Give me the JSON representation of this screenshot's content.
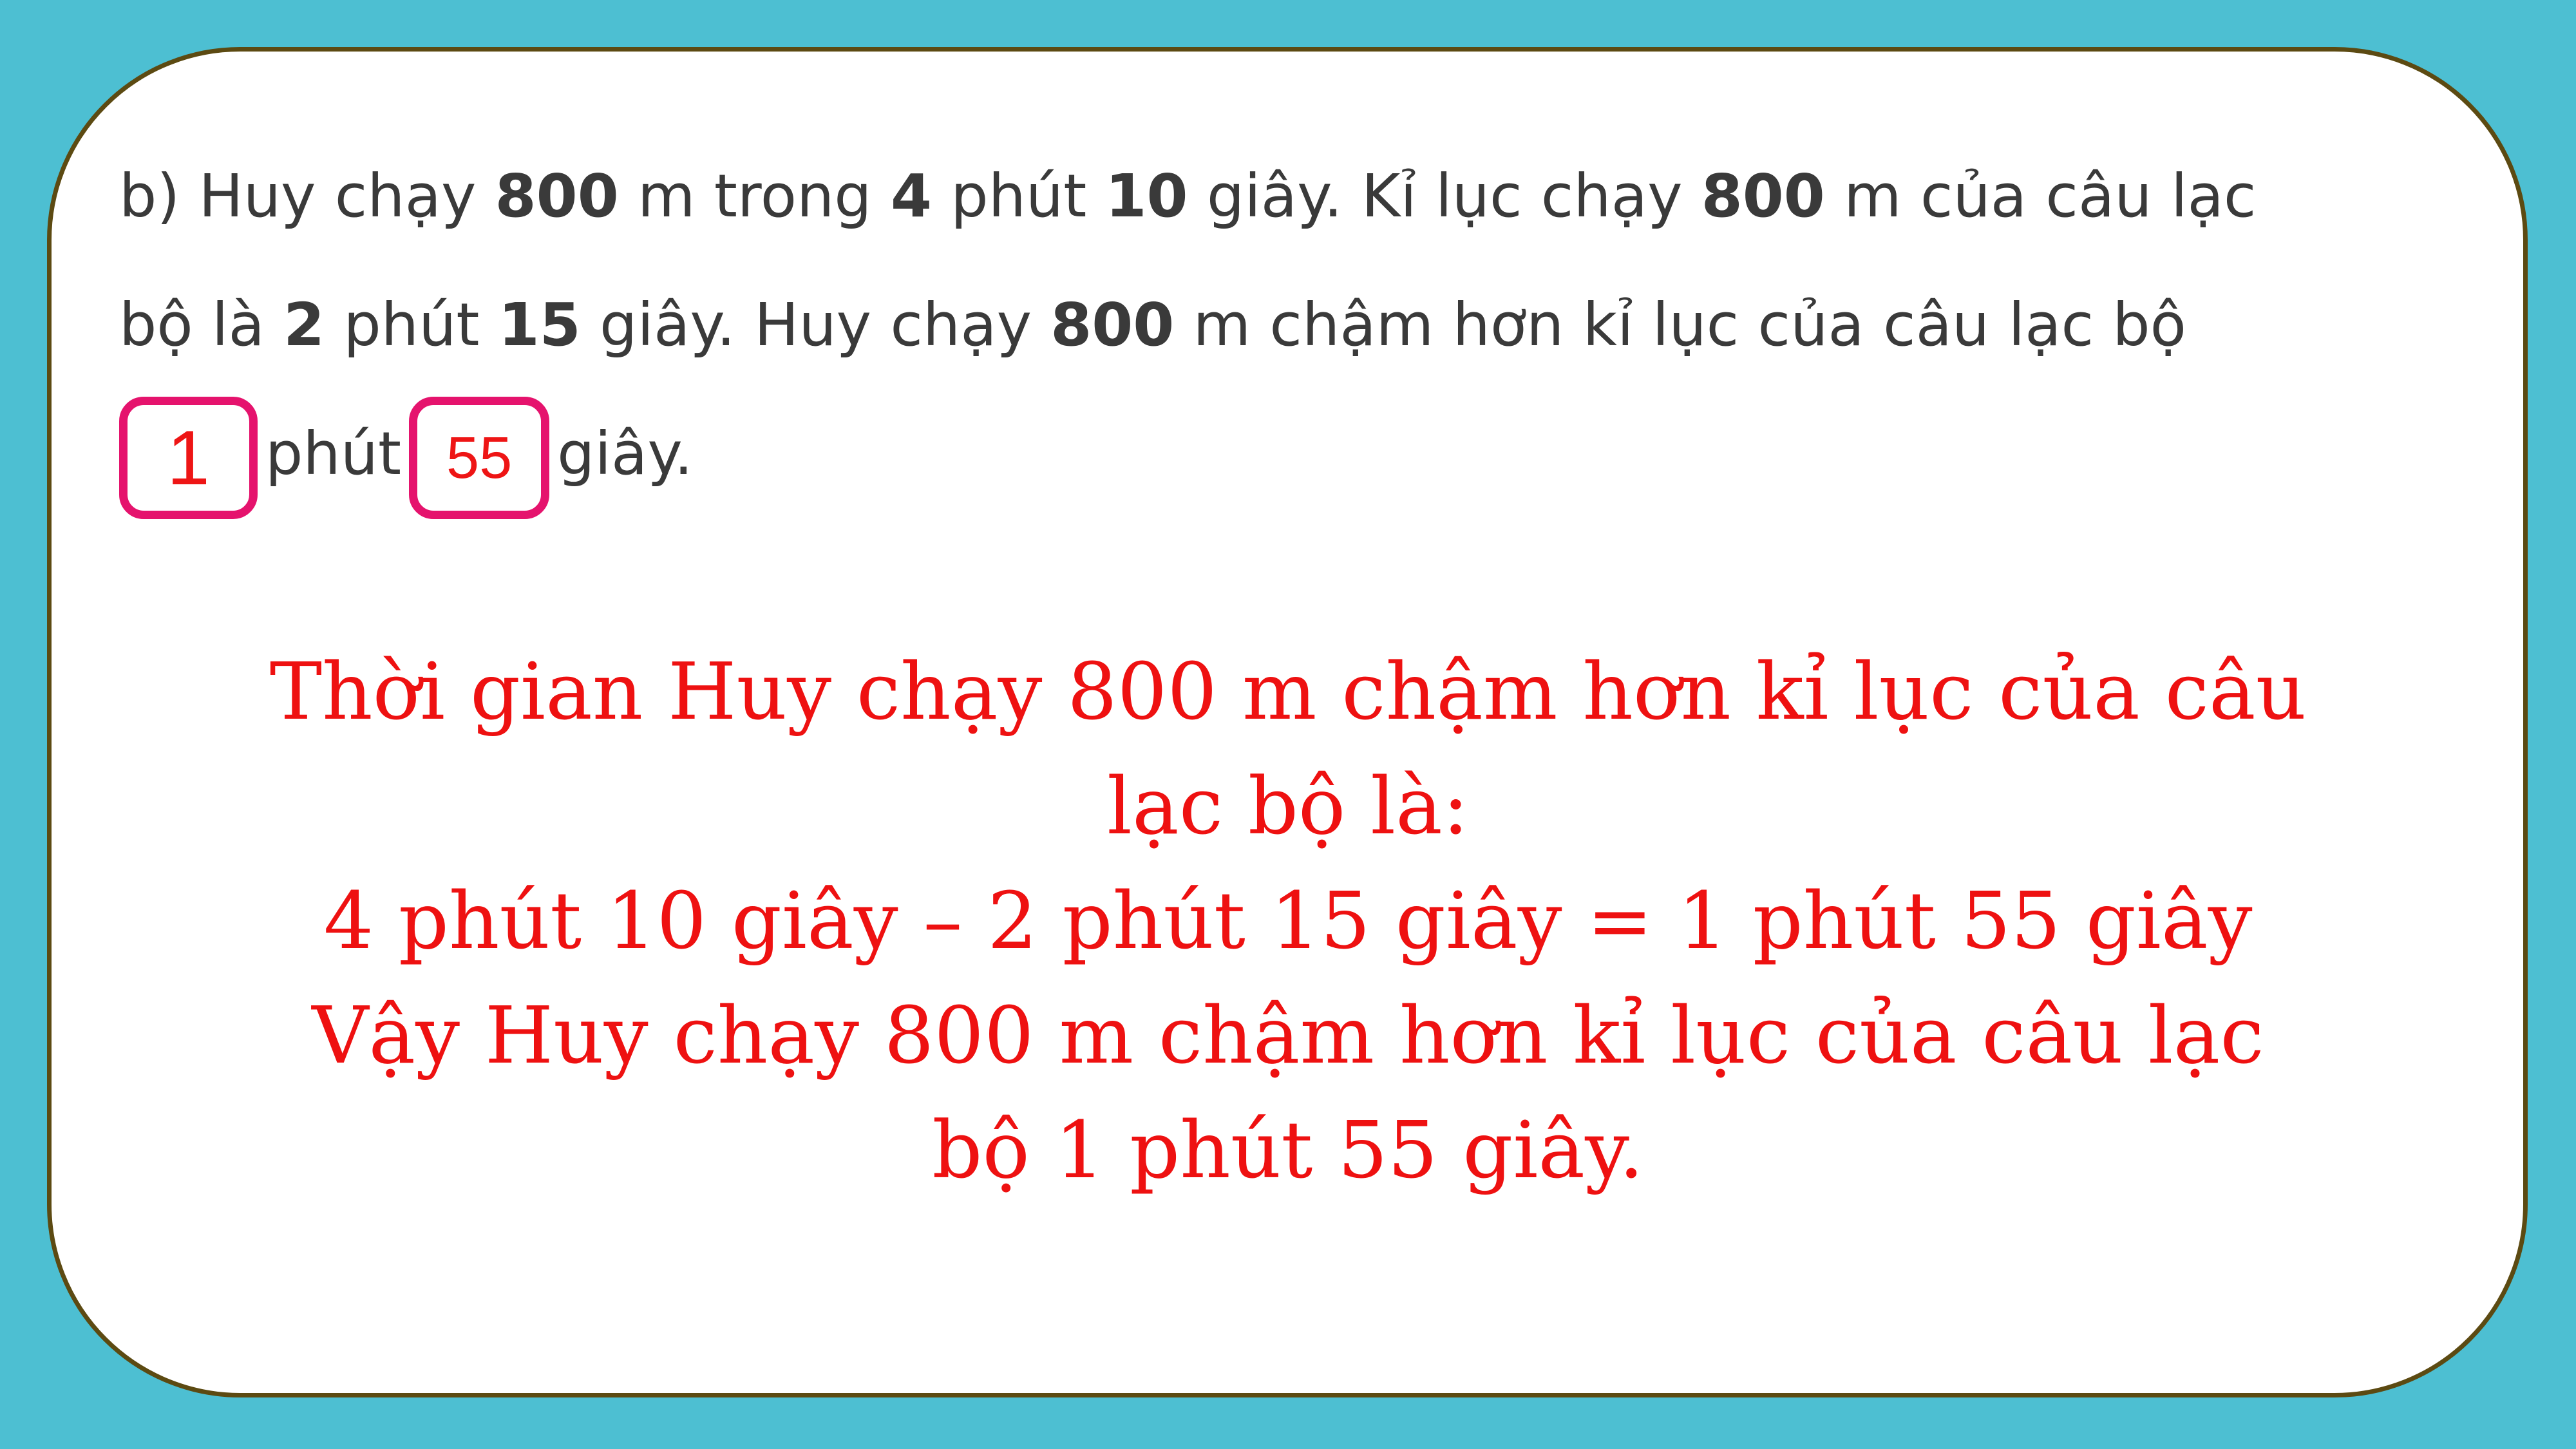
{
  "problem": {
    "line1": {
      "t1": "b) Huy chạy ",
      "b1": "800",
      "t2": " m trong ",
      "b2": "4",
      "t3": " phút ",
      "b3": "10",
      "t4": " giây. Kỉ lục chạy ",
      "b4": "800",
      "t5": " m của câu lạc"
    },
    "line2": {
      "t1": "bộ là ",
      "b1": "2",
      "t2": " phút ",
      "b2": "15",
      "t3": " giây. Huy chạy ",
      "b3": "800",
      "t4": " m chậm hơn kỉ lục của câu lạc bộ"
    },
    "line3": {
      "box1_value": "1",
      "t1": "phút",
      "box2_value": "55",
      "t2": "giây."
    }
  },
  "solution": {
    "line1": "Thời gian Huy chạy 800 m chậm hơn kỉ lục của câu",
    "line2": "lạc bộ là:",
    "line3": "4 phút 10 giây – 2 phút 15 giây = 1 phút 55 giây",
    "line4": "Vậy Huy chạy 800 m chậm hơn kỉ lục của câu lạc",
    "line5": "bộ 1 phút 55 giây."
  },
  "colors": {
    "background": "#4dbfd2",
    "card": "#ffffff",
    "card_border": "#5c4a12",
    "answer_box_border": "#e5136d",
    "answer_text": "#ee1515",
    "problem_text": "#3a3a3a"
  }
}
